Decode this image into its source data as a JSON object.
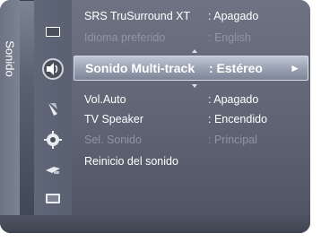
{
  "menu": {
    "title": "Sonido",
    "items": [
      {
        "label": "SRS TruSurround XT",
        "value": ": Apagado",
        "state": "normal"
      },
      {
        "label": "Idioma preferido",
        "value": ": English",
        "state": "disabled"
      },
      {
        "label": "Sonido Multi-track",
        "value": ": Estéreo",
        "state": "selected"
      },
      {
        "label": "Vol.Auto",
        "value": ": Apagado",
        "state": "normal"
      },
      {
        "label": "TV Speaker",
        "value": ": Encendido",
        "state": "normal"
      },
      {
        "label": "Sel. Sonido",
        "value": ": Principal",
        "state": "disabled"
      },
      {
        "label": "Reinicio del sonido",
        "value": "",
        "state": "normal"
      }
    ],
    "selected_arrow": "►"
  },
  "sidebar_icons": [
    "picture-icon",
    "sound-icon",
    "channel-icon",
    "setup-icon",
    "input-icon",
    "application-icon"
  ]
}
